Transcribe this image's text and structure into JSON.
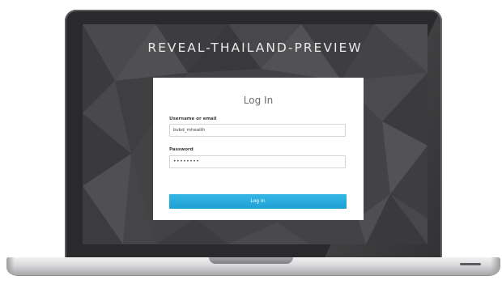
{
  "app": {
    "title": "REVEAL-THAILAND-PREVIEW"
  },
  "login": {
    "heading": "Log In",
    "username_label": "Username or email",
    "username_value": "bvbd_mhealth",
    "password_label": "Password",
    "password_value": "••••••••",
    "submit_label": "Log In"
  },
  "colors": {
    "accent": "#24a9dd",
    "background": "#3f3f42",
    "card": "#ffffff"
  }
}
